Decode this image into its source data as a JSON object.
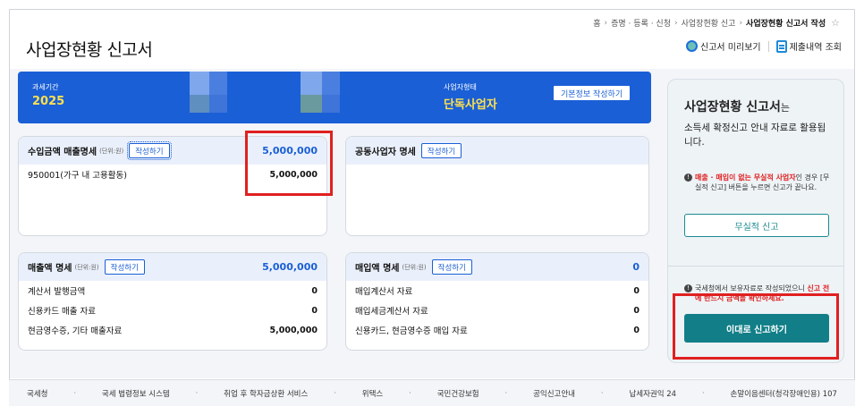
{
  "breadcrumb": [
    "홈",
    "증명 · 등록 · 신청",
    "사업장현황 신고",
    "사업장현황 신고서 작성"
  ],
  "breadcrumb_sep": "›",
  "page_title": "사업장현황 신고서",
  "header_actions": {
    "preview_label": "신고서 미리보기",
    "history_label": "제출내역 조회"
  },
  "banner": {
    "period_label": "과세기간",
    "period_value": "2025",
    "type_label": "사업자형태",
    "type_value": "단독사업자",
    "basic_info_button": "기본정보 작성하기"
  },
  "cards": {
    "income": {
      "title": "수입금액 매출명세",
      "unit": "(단위:원)",
      "button": "작성하기",
      "total": "5,000,000",
      "rows": [
        {
          "label": "950001(가구 내 고용활동)",
          "value": "5,000,000"
        }
      ]
    },
    "partner": {
      "title": "공동사업자 명세",
      "button": "작성하기"
    },
    "sales": {
      "title": "매출액 명세",
      "unit": "(단위:원)",
      "button": "작성하기",
      "total": "5,000,000",
      "rows": [
        {
          "label": "계산서 발행금액",
          "value": "0"
        },
        {
          "label": "신용카드 매출 자료",
          "value": "0"
        },
        {
          "label": "현금영수증, 기타 매출자료",
          "value": "5,000,000"
        }
      ]
    },
    "purchase": {
      "title": "매입액 명세",
      "unit": "(단위:원)",
      "button": "작성하기",
      "total": "0",
      "rows": [
        {
          "label": "매입계산서 자료",
          "value": "0"
        },
        {
          "label": "매입세금계산서 자료",
          "value": "0"
        },
        {
          "label": "신용카드, 현금영수증 매입 자료",
          "value": "0"
        }
      ]
    }
  },
  "side": {
    "title": "사업장현황 신고서",
    "title_suffix": "는",
    "desc": "소득세 확정신고 안내 자료로 활용됩니다.",
    "notice1_red": "매출 · 매입이 없는 무실적 사업자",
    "notice1_rest": "인 경우 [무실적 신고] 버튼을 누르면 신고가 끝나요.",
    "no_record_button": "무실적 신고",
    "notice2_text": "국세청에서 보유자료로 작성되었으니",
    "notice2_red": "신고 전에 반드시 금액을 확인하세요.",
    "submit_button": "이대로 신고하기"
  },
  "footer": [
    "국세청",
    "국세 법령정보 시스템",
    "취업 후 학자금상환 서비스",
    "위택스",
    "국민건강보험",
    "공익신고안내",
    "납세자권익 24",
    "손말이음센터(청각장애인용) 107"
  ],
  "footer_sep": "·",
  "colors": {
    "primary": "#1a5fd6",
    "highlight": "#ffe14d",
    "teal": "#127f88",
    "annotation_red": "#e02020"
  }
}
